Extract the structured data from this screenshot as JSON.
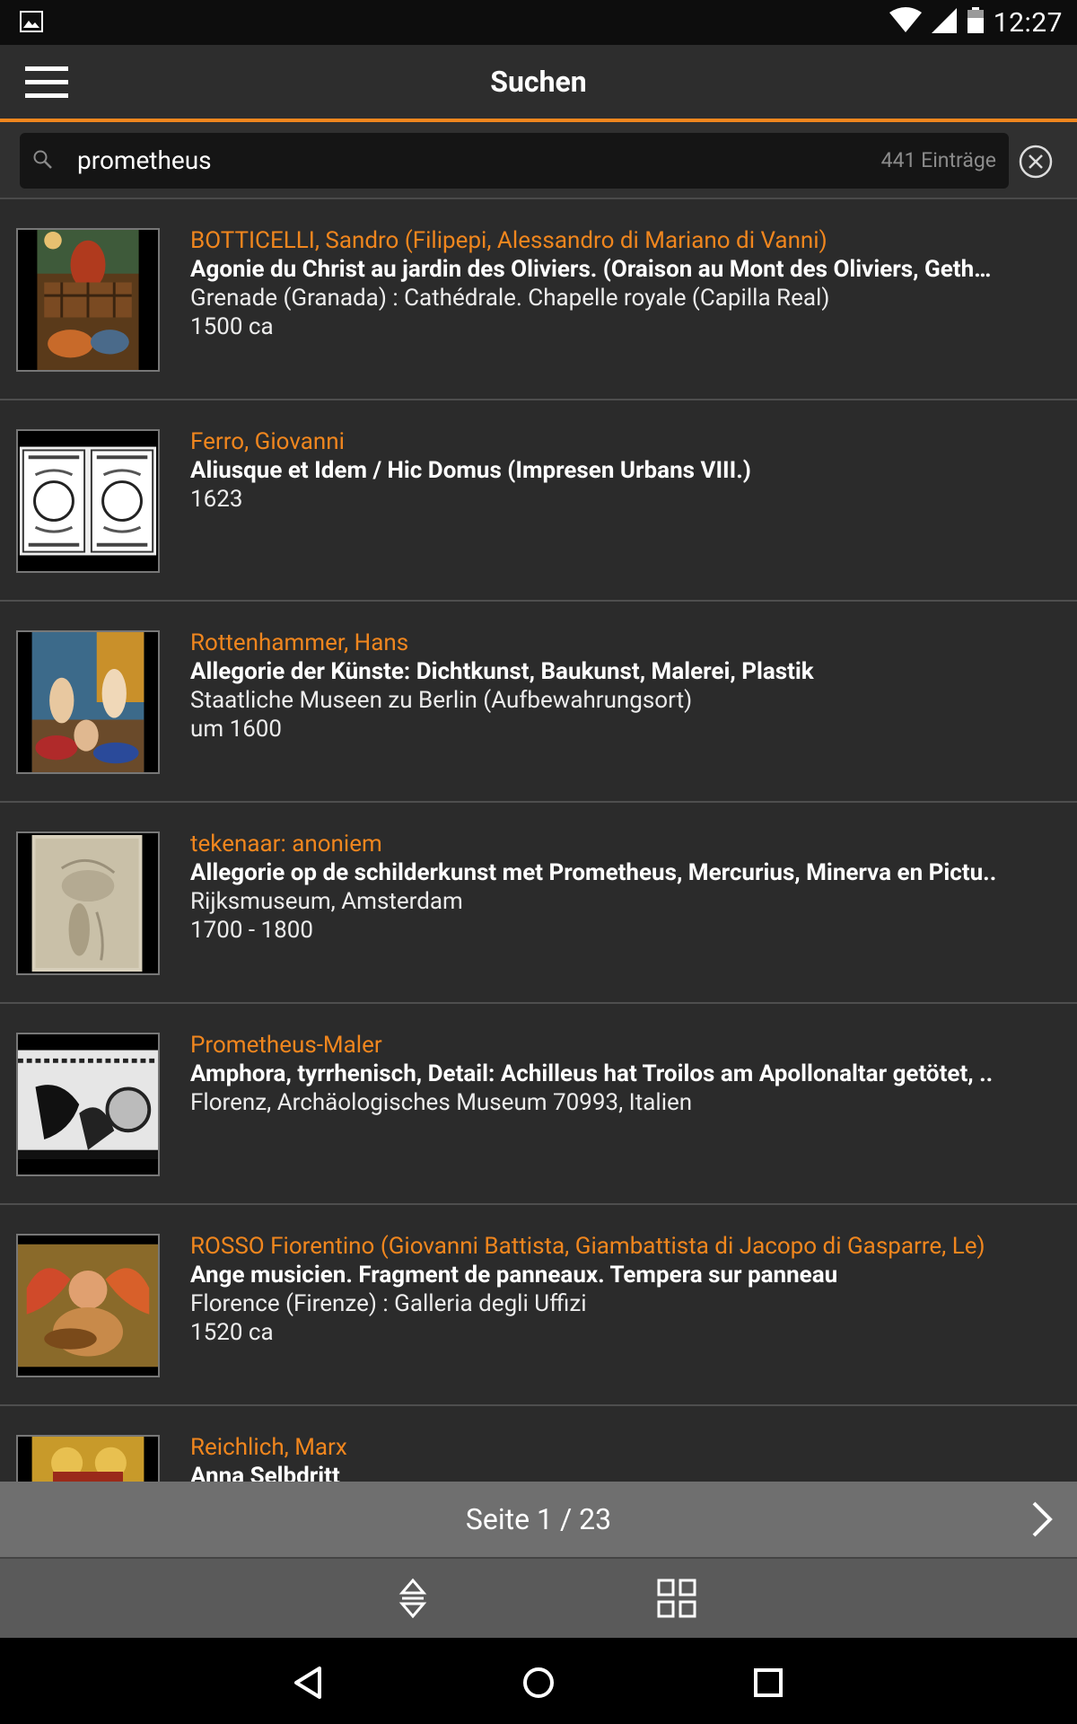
{
  "status_bar": {
    "time": "12:27"
  },
  "app_bar": {
    "title": "Suchen"
  },
  "search": {
    "query": "prometheus",
    "count_label": "441 Einträge"
  },
  "results": [
    {
      "artist": "BOTTICELLI, Sandro (Filipepi, Alessandro di Mariano di Vanni)",
      "title": "Agonie du Christ au jardin des Oliviers. (Oraison au Mont des Oliviers, Geth…",
      "location": "Grenade (Granada) : Cathédrale. Chapelle royale (Capilla Real)",
      "date": "1500 ca"
    },
    {
      "artist": "Ferro, Giovanni",
      "title": "Aliusque et Idem / Hic Domus (Impresen Urbans VIII.)",
      "location": "1623",
      "date": ""
    },
    {
      "artist": "Rottenhammer, Hans",
      "title": "Allegorie der Künste: Dichtkunst, Baukunst, Malerei, Plastik",
      "location": "Staatliche Museen zu Berlin (Aufbewahrungsort)",
      "date": "um 1600"
    },
    {
      "artist": "tekenaar: anoniem",
      "title": "Allegorie op de schilderkunst met Prometheus, Mercurius, Minerva en Pictu..",
      "location": "Rijksmuseum, Amsterdam",
      "date": "1700 - 1800"
    },
    {
      "artist": "Prometheus-Maler",
      "title": "Amphora, tyrrhenisch, Detail: Achilleus hat Troilos am Apollonaltar getötet, ..",
      "location": "Florenz, Archäologisches Museum 70993, Italien",
      "date": ""
    },
    {
      "artist": "ROSSO Fiorentino (Giovanni Battista, Giambattista di Jacopo di Gasparre, Le)",
      "title": "Ange musicien. Fragment de panneaux. Tempera sur panneau",
      "location": "Florence (Firenze) : Galleria degli Uffizi",
      "date": "1520 ca"
    },
    {
      "artist": "Reichlich, Marx",
      "title": "Anna Selbdritt",
      "location": "",
      "date": ""
    }
  ],
  "pager": {
    "label": "Seite 1 / 23"
  },
  "icons": {
    "menu": "menu-icon",
    "search": "search-icon",
    "clear": "clear-circle-x-icon",
    "next": "chevron-right-icon",
    "sort": "sort-up-down-icon",
    "grid": "grid-view-icon",
    "nav_back": "triangle-back-icon",
    "nav_home": "circle-home-icon",
    "nav_recents": "square-recents-icon"
  },
  "colors": {
    "accent": "#f0861e",
    "background": "#2b2b2b"
  }
}
